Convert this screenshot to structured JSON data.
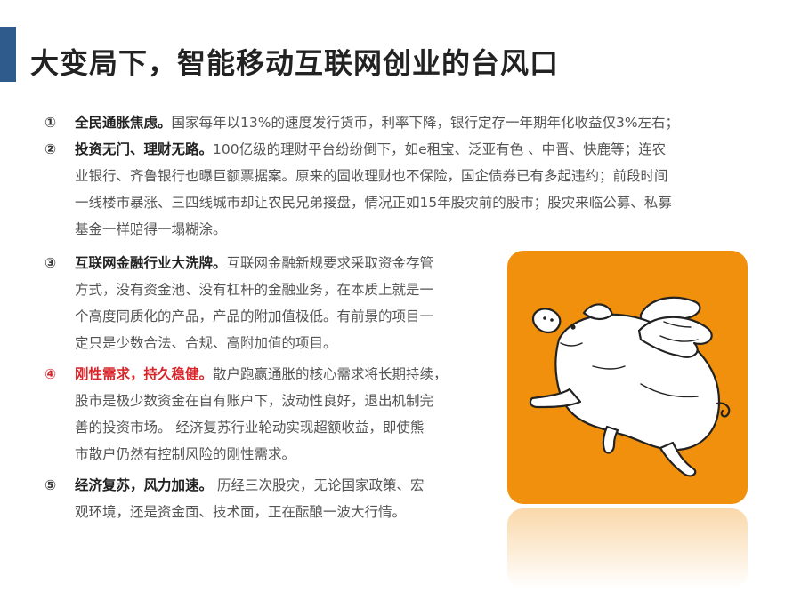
{
  "title": "大变局下，智能移动互联网创业的台风口",
  "items": [
    {
      "num": "①",
      "head": "全民通胀焦虑。",
      "lines": [
        "国家每年以13%的速度发行货币，利率下降，银行定存一年期年化收益仅3%左右；"
      ]
    },
    {
      "num": "②",
      "head": "投资无门、理财无路。",
      "lines": [
        "100亿级的理财平台纷纷倒下，如e租宝、泛亚有色 、中晋、快鹿等；连农",
        "业银行、齐鲁银行也曝巨额票据案。原来的固收理财也不保险，国企债券已有多起违约；前段时间",
        "一线楼市暴涨、三四线城市却让农民兄弟接盘，情况正如15年股灾前的股市；股灾来临公募、私募",
        "基金一样赔得一塌糊涂。"
      ]
    },
    {
      "num": "③",
      "head": "互联网金融行业大洗牌。",
      "lines": [
        "互联网金融新规要求采取资金存管",
        "方式，没有资金池、没有杠杆的金融业务，在本质上就是一",
        "个高度同质化的产品，产品的附加值极低。有前景的项目一",
        "定只是少数合法、合规、高附加值的项目。"
      ]
    },
    {
      "num": "④",
      "head": "刚性需求，持久稳健。",
      "lines": [
        "散户跑赢通胀的核心需求将长期持续，",
        "股市是极少数资金在自有账户下，波动性良好，退出机制完",
        "善的投资市场。 经济复苏行业轮动实现超额收益，即使熊",
        "市散户仍然有控制风险的刚性需求。"
      ]
    },
    {
      "num": "⑤",
      "head": "经济复苏，风力加速。",
      "lines": [
        " 历经三次股灾，无论国家政策、宏",
        "观环境，还是资金面、技术面，正在酝酿一波大行情。"
      ]
    }
  ],
  "colors": {
    "accent_bar": "#2e5b8c",
    "highlight": "#d8262b",
    "card": "#f0900c"
  },
  "illustration": {
    "icon": "flying-pig-icon"
  }
}
